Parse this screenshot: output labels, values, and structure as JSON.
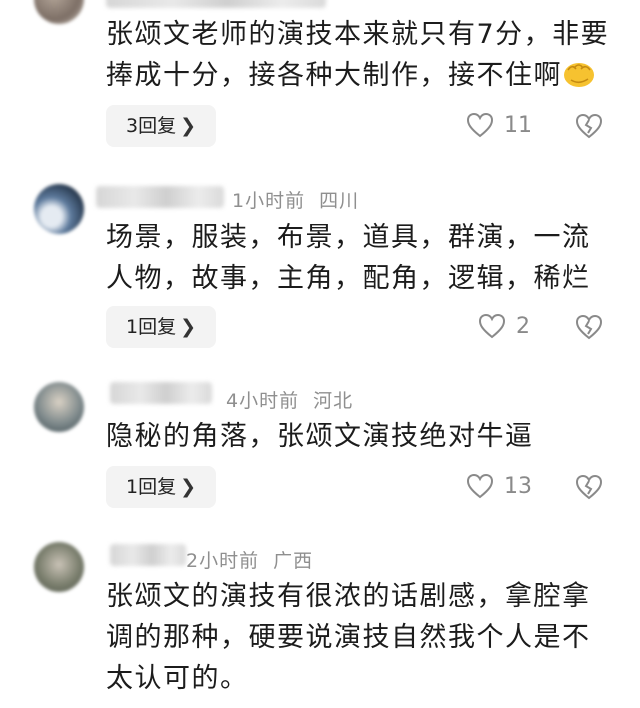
{
  "comments": [
    {
      "time": "",
      "location": "",
      "text": "张颂文老师的演技本来就只有7分，非要捧成十分，接各种大制作，接不住啊",
      "reply_label": "3回复",
      "likes": "11"
    },
    {
      "time": "1小时前",
      "location": "四川",
      "text": "场景，服装，布景，道具，群演，一流人物，故事，主角，配角，逻辑，稀烂",
      "reply_label": "1回复",
      "likes": "2"
    },
    {
      "time": "4小时前",
      "location": "河北",
      "text": "隐秘的角落，张颂文演技绝对牛逼",
      "reply_label": "1回复",
      "likes": "13"
    },
    {
      "time": "2小时前",
      "location": "广西",
      "text": "张颂文的演技有很浓的话剧感，拿腔拿调的那种，硬要说演技自然我个人是不太认可的。"
    }
  ],
  "icons": {
    "reply_chevron": "chevron-right-icon",
    "like": "heart-outline-icon",
    "dislike": "broken-heart-icon",
    "clap": "clapping-hands-emoji"
  },
  "colors": {
    "meta_gray": "#8f8f8f",
    "reply_bg": "#f3f3f3",
    "emoji_yellow": "#f6c230"
  }
}
